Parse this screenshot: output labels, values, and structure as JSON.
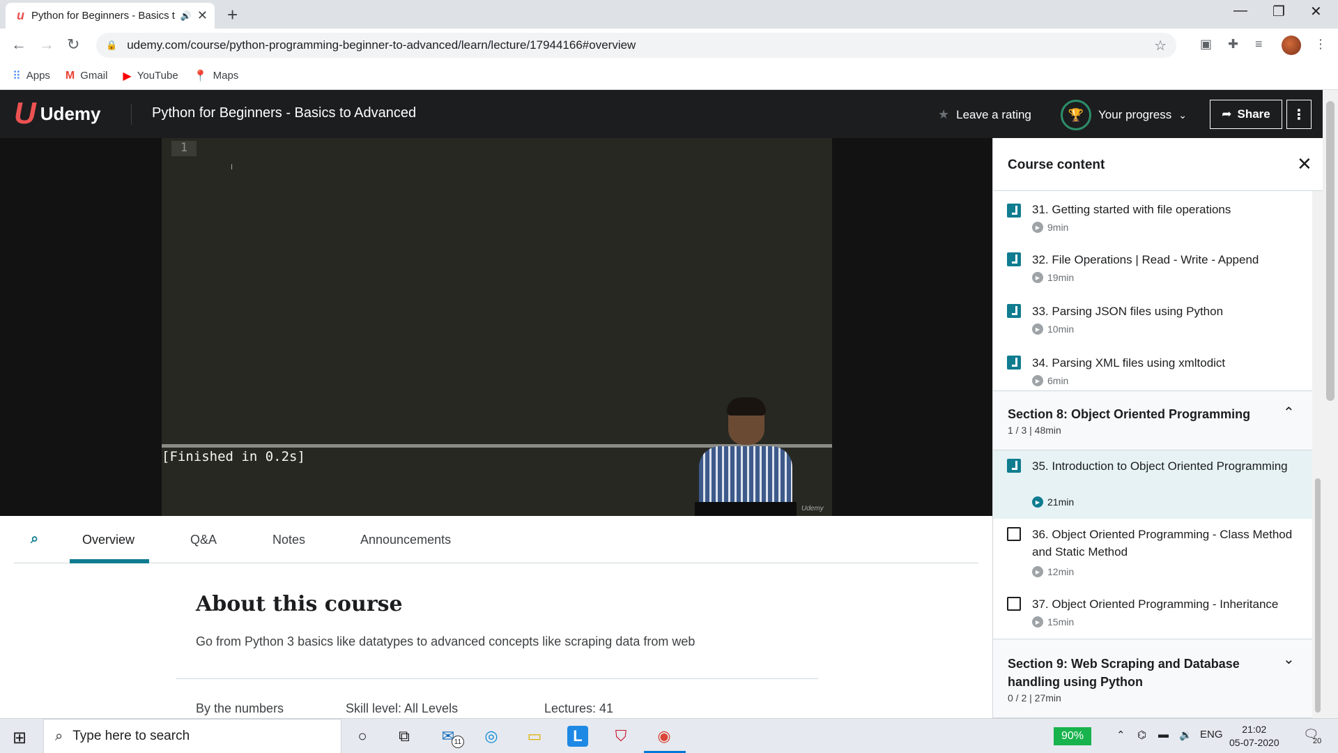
{
  "browser": {
    "tab_title": "Python for Beginners - Basics to Advanced",
    "url": "udemy.com/course/python-programming-beginner-to-advanced/learn/lecture/17944166#overview",
    "bookmarks": [
      {
        "label": "Apps",
        "icon": "apps-grid-icon"
      },
      {
        "label": "Gmail",
        "icon": "gmail-icon"
      },
      {
        "label": "YouTube",
        "icon": "youtube-icon"
      },
      {
        "label": "Maps",
        "icon": "maps-icon"
      }
    ]
  },
  "header": {
    "brand": "Udemy",
    "course_title": "Python for Beginners - Basics to Advanced",
    "leave_rating": "Leave a rating",
    "your_progress": "Your progress",
    "share": "Share"
  },
  "video": {
    "line_number": "1",
    "console_output": "[Finished in 0.2s]",
    "watermark": "Udemy"
  },
  "tabs": [
    "Overview",
    "Q&A",
    "Notes",
    "Announcements"
  ],
  "active_tab": "Overview",
  "about": {
    "heading": "About this course",
    "description": "Go from Python 3 basics like datatypes to advanced concepts like scraping data from web",
    "by_numbers": "By the numbers",
    "skill_level": "Skill level: All Levels",
    "lectures": "Lectures: 41"
  },
  "sidebar": {
    "title": "Course content",
    "lectures_top": [
      {
        "title": "31. Getting started with file operations",
        "duration": "9min",
        "done": true
      },
      {
        "title": "32. File Operations | Read - Write - Append",
        "duration": "19min",
        "done": true
      },
      {
        "title": "33. Parsing JSON files using Python",
        "duration": "10min",
        "done": true
      },
      {
        "title": "34. Parsing XML files using xmltodict",
        "duration": "6min",
        "done": true
      }
    ],
    "section8": {
      "title": "Section 8: Object Oriented Programming",
      "meta": "1 / 3 | 48min"
    },
    "section8_lectures": [
      {
        "title": "35. Introduction to Object Oriented Programming",
        "duration": "21min",
        "done": true
      },
      {
        "title": "36. Object Oriented Programming - Class Method and Static Method",
        "duration": "12min",
        "done": false
      },
      {
        "title": "37. Object Oriented Programming - Inheritance",
        "duration": "15min",
        "done": false
      }
    ],
    "section9": {
      "title": "Section 9: Web Scraping and Database handling using Python",
      "meta": "0 / 2 | 27min"
    }
  },
  "taskbar": {
    "search_placeholder": "Type here to search",
    "battery": "90%",
    "mail_badge": "11",
    "language": "ENG",
    "time": "21:02",
    "date": "05-07-2020",
    "notifications": "20"
  }
}
